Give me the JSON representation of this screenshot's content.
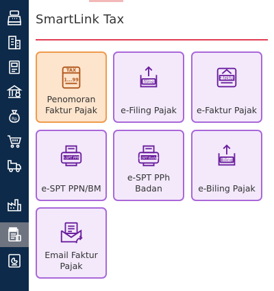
{
  "app": {
    "title": "SmartLink Tax"
  },
  "sidebar": {
    "items": [
      {
        "icon": "cash-register-icon",
        "active": false
      },
      {
        "icon": "building-icon",
        "active": false
      },
      {
        "icon": "ledger-book-icon",
        "active": false
      },
      {
        "icon": "bank-icon",
        "active": false
      },
      {
        "icon": "money-bag-icon",
        "active": false
      },
      {
        "icon": "shopping-cart-icon",
        "active": false
      },
      {
        "icon": "delivery-truck-icon",
        "active": false
      },
      {
        "icon": "factory-icon",
        "active": false
      },
      {
        "icon": "tax-document-icon",
        "active": true
      },
      {
        "icon": "report-chart-icon",
        "active": false
      }
    ]
  },
  "tiles": [
    {
      "label": "Penomoran Faktur Pajak",
      "icon": "tax-invoice-icon",
      "icon_text": "TAX",
      "icon_subtext": "1...99",
      "selected": true
    },
    {
      "label": "e-Filing Pajak",
      "icon": "efiling-upload-icon",
      "icon_text": "filing",
      "selected": false
    },
    {
      "label": "e-Faktur Pajak",
      "icon": "efaktur-icon",
      "icon_text": "e-faktur",
      "selected": false
    },
    {
      "label": "e-SPT PPN/BM",
      "icon": "espt-ppn-printer-icon",
      "icon_text": "e-SPT PPN",
      "selected": false
    },
    {
      "label": "e-SPT PPh Badan",
      "icon": "espt-badan-printer-icon",
      "icon_text": "e-SPT Badan",
      "selected": false
    },
    {
      "label": "e-Biling Pajak",
      "icon": "ebilling-upload-icon",
      "icon_text": "Biling",
      "selected": false
    },
    {
      "label": "Email Faktur Pajak",
      "icon": "email-invoice-icon",
      "selected": false
    }
  ],
  "colors": {
    "sidebar_bg": "#0e2a4a",
    "sidebar_active": "#6e7581",
    "accent_line": "#e13c52",
    "tile_border": "#a967d9",
    "tile_bg": "#f3e9fb",
    "tile_icon": "#6b1f9e",
    "selected_border": "#f09a4a",
    "selected_bg": "#fde4cc",
    "selected_icon": "#b0561a"
  }
}
